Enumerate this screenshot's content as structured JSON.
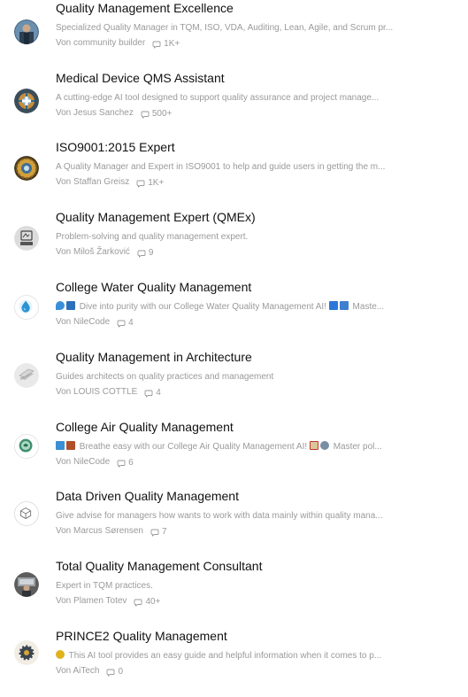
{
  "items": [
    {
      "title": "Quality Management Excellence",
      "description": "Specialized Quality Manager in TQM, ISO, VDA, Auditing, Lean, Agile, and Scrum pr...",
      "author": "Von community builder",
      "count": "1K+"
    },
    {
      "title": "Medical Device QMS Assistant",
      "description": "A cutting-edge AI tool designed to support quality assurance and project manage...",
      "author": "Von Jesus Sanchez",
      "count": "500+"
    },
    {
      "title": "ISO9001:2015 Expert",
      "description": "A Quality Manager and Expert in ISO9001 to help and guide users in getting the m...",
      "author": "Von Staffan Greisz",
      "count": "1K+"
    },
    {
      "title": "Quality Management Expert (QMEx)",
      "description": "Problem-solving and quality management expert.",
      "author": "Von Miloš Žarković",
      "count": "9"
    },
    {
      "title": "College Water Quality Management",
      "description": "Dive into purity with our College Water Quality Management AI!",
      "description_tail": "Maste...",
      "author": "Von NileCode",
      "count": "4"
    },
    {
      "title": "Quality Management in Architecture",
      "description": "Guides architects on quality practices and management",
      "author": "Von LOUIS COTTLE",
      "count": "4"
    },
    {
      "title": "College Air Quality Management",
      "description": "Breathe easy with our College Air Quality Management AI!",
      "description_tail": "Master pol...",
      "author": "Von NileCode",
      "count": "6"
    },
    {
      "title": "Data Driven Quality Management",
      "description": "Give advise for managers how wants to work with data mainly within quality mana...",
      "author": "Von Marcus Sørensen",
      "count": "7"
    },
    {
      "title": "Total Quality Management Consultant",
      "description": "Expert in TQM practices.",
      "author": "Von Plamen Totev",
      "count": "40+"
    },
    {
      "title": "PRINCE2 Quality Management",
      "description": "This AI tool provides an easy guide and helpful information when it comes to p...",
      "author": "Von AiTech",
      "count": "0"
    }
  ],
  "icons": {
    "chat": "chat-bubble-icon",
    "avatars": [
      "person-photo-avatar",
      "medical-globe-avatar",
      "iso-gear-avatar",
      "qmex-logo-avatar",
      "water-drop-avatar",
      "layers-avatar",
      "globe-leaf-avatar",
      "cube-outline-avatar",
      "consultant-photo-avatar",
      "gear-cog-avatar"
    ]
  },
  "colors": {
    "title": "#111111",
    "muted": "#9a9a9a",
    "background": "#ffffff"
  }
}
